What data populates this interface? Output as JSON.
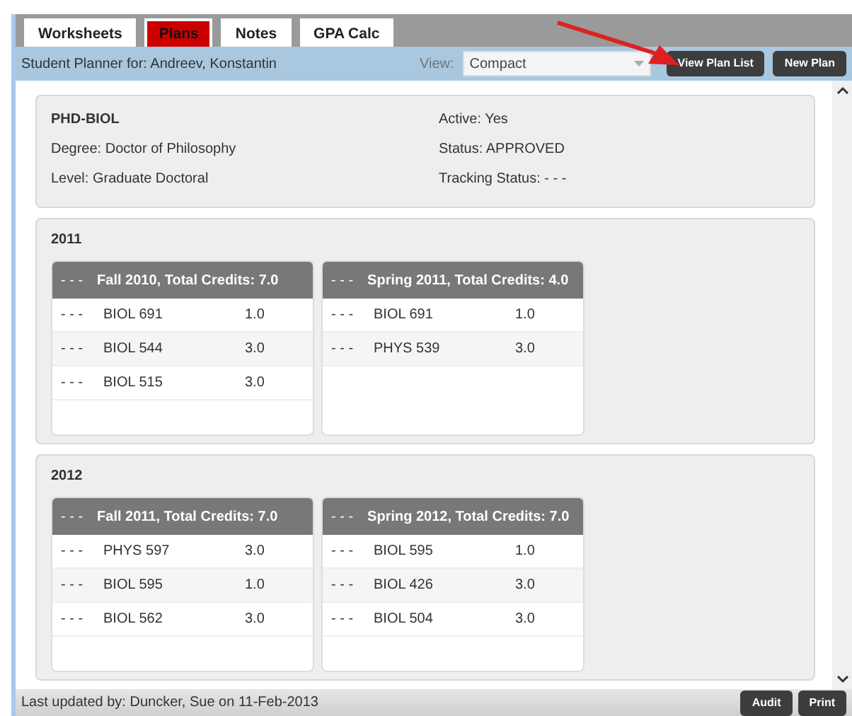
{
  "tabs": [
    {
      "label": "Worksheets",
      "selected": false
    },
    {
      "label": "Plans",
      "selected": true
    },
    {
      "label": "Notes",
      "selected": false
    },
    {
      "label": "GPA Calc",
      "selected": false
    }
  ],
  "toolbar": {
    "student": "Student Planner for: Andreev, Konstantin",
    "view_label": "View:",
    "view_value": "Compact",
    "buttons": [
      "View Plan List",
      "New Plan"
    ]
  },
  "plan": {
    "code": "PHD-BIOL",
    "left": [
      "Degree: Doctor of Philosophy",
      "Level: Graduate Doctoral"
    ],
    "right": [
      "Active: Yes",
      "Status: APPROVED",
      "Tracking Status: - - -"
    ]
  },
  "years": [
    {
      "year": "2011",
      "terms": [
        {
          "marker": "- - -",
          "title": "Fall 2010, Total Credits: 7.0",
          "courses": [
            {
              "status": "- - -",
              "course": "BIOL 691",
              "credits": "1.0"
            },
            {
              "status": "- - -",
              "course": "BIOL 544",
              "credits": "3.0"
            },
            {
              "status": "- - -",
              "course": "BIOL 515",
              "credits": "3.0"
            }
          ]
        },
        {
          "marker": "- - -",
          "title": "Spring 2011, Total Credits: 4.0",
          "courses": [
            {
              "status": "- - -",
              "course": "BIOL 691",
              "credits": "1.0"
            },
            {
              "status": "- - -",
              "course": "PHYS 539",
              "credits": "3.0"
            }
          ]
        }
      ]
    },
    {
      "year": "2012",
      "terms": [
        {
          "marker": "- - -",
          "title": "Fall 2011, Total Credits: 7.0",
          "courses": [
            {
              "status": "- - -",
              "course": "PHYS 597",
              "credits": "3.0"
            },
            {
              "status": "- - -",
              "course": "BIOL 595",
              "credits": "1.0"
            },
            {
              "status": "- - -",
              "course": "BIOL 562",
              "credits": "3.0"
            }
          ]
        },
        {
          "marker": "- - -",
          "title": "Spring 2012, Total Credits: 7.0",
          "courses": [
            {
              "status": "- - -",
              "course": "BIOL 595",
              "credits": "1.0"
            },
            {
              "status": "- - -",
              "course": "BIOL 426",
              "credits": "3.0"
            },
            {
              "status": "- - -",
              "course": "BIOL 504",
              "credits": "3.0"
            }
          ]
        }
      ]
    }
  ],
  "footer": {
    "text": "Last updated by: Duncker, Sue on 11-Feb-2013",
    "buttons": [
      "Audit",
      "Print"
    ]
  }
}
